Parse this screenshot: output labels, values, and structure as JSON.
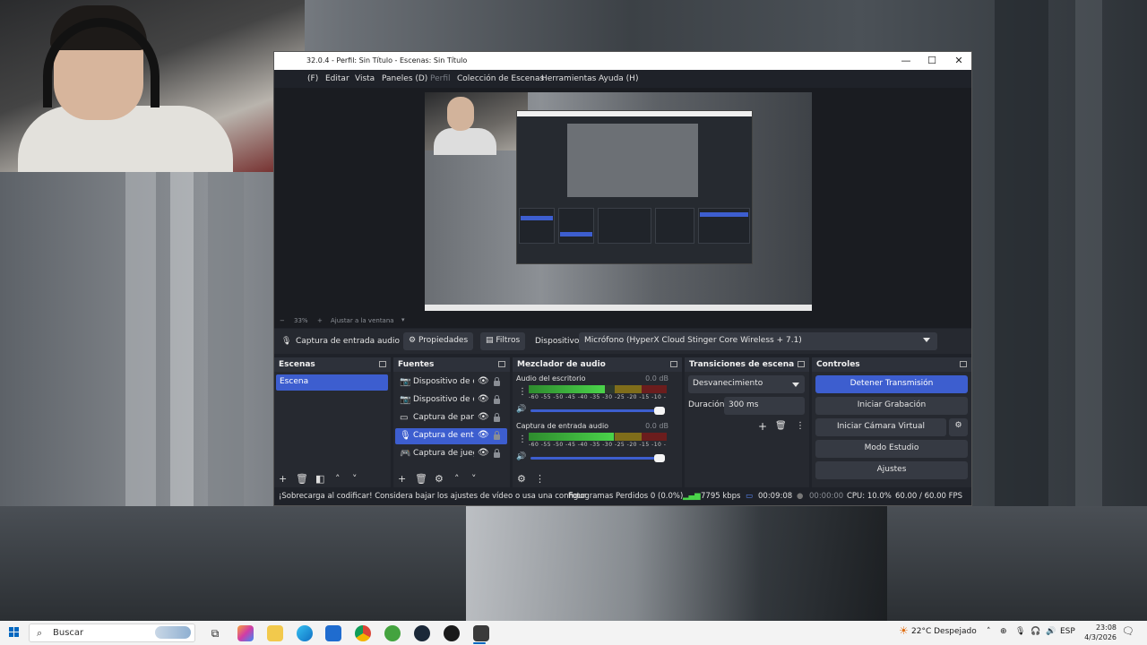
{
  "window": {
    "title": "32.0.4 - Perfil: Sin Título - Escenas: Sin Título",
    "controls": {
      "minimize": "—",
      "maximize": "☐",
      "close": "✕"
    }
  },
  "menu": [
    "(F)",
    "Editar",
    "Vista",
    "Paneles (D)",
    "Perfil",
    "Colección de Escenas",
    "Herramientas",
    "Ayuda (H)"
  ],
  "zoom": {
    "minus": "−",
    "value": "33%",
    "plus": "+",
    "fit_label": "Ajustar a la ventana"
  },
  "source_toolbar": {
    "source_name": "Captura de entrada audio",
    "properties": "Propiedades",
    "filters": "Filtros",
    "device_label": "Dispositivo",
    "device_value": "Micrófono (HyperX Cloud Stinger Core Wireless + 7.1)"
  },
  "scenes": {
    "title": "Escenas",
    "items": [
      "Escena"
    ]
  },
  "sources": {
    "title": "Fuentes",
    "items": [
      {
        "label": "Dispositivo de ca",
        "icon": "camera-icon"
      },
      {
        "label": "Dispositivo de ca",
        "icon": "camera-icon"
      },
      {
        "label": "Captura de pant",
        "icon": "monitor-icon"
      },
      {
        "label": "Captura de entra",
        "icon": "microphone-icon",
        "selected": true
      },
      {
        "label": "Captura de juego",
        "icon": "gamepad-icon"
      }
    ]
  },
  "mixer": {
    "title": "Mezclador de audio",
    "ticks": "-60 -55 -50 -45 -40 -35 -30 -25 -20 -15 -10 -5 0",
    "channels": [
      {
        "name": "Audio del escritorio",
        "db": "0.0 dB",
        "level": 0.55,
        "volume": 1.0
      },
      {
        "name": "Captura de entrada audio",
        "db": "0.0 dB",
        "level": 0.62,
        "volume": 1.0
      }
    ]
  },
  "transitions": {
    "title": "Transiciones de escena",
    "selected": "Desvanecimiento",
    "duration_label": "Duración",
    "duration_value": "300 ms"
  },
  "controls": {
    "title": "Controles",
    "stop_stream": "Detener Transmisión",
    "start_recording": "Iniciar Grabación",
    "virtual_cam": "Iniciar Cámara Virtual",
    "studio_mode": "Modo Estudio",
    "settings": "Ajustes"
  },
  "status": {
    "warning": "¡Sobrecarga al codificar! Considera bajar los ajustes de vídeo o usa una configur",
    "dropped": "Fotogramas Perdidos 0 (0.0%)",
    "bitrate": "7795 kbps",
    "stream_time": "00:09:08",
    "rec_time": "00:00:00",
    "cpu": "CPU: 10.0%",
    "fps": "60.00 / 60.00 FPS"
  },
  "taskbar": {
    "search_placeholder": "Buscar",
    "weather": "22°C  Despejado",
    "lang": "ESP",
    "time": "23:08",
    "date": "4/3/2026",
    "apps": [
      "task-view-icon",
      "copilot-icon",
      "file-explorer-icon",
      "edge-icon",
      "store-icon",
      "chrome-icon",
      "app-icon",
      "steam-icon",
      "obs-icon",
      "media-icon"
    ]
  },
  "colors": {
    "accent": "#3d5ecf",
    "panel": "#262930",
    "window": "#1f2229",
    "taskbar": "#f3f3f3"
  }
}
